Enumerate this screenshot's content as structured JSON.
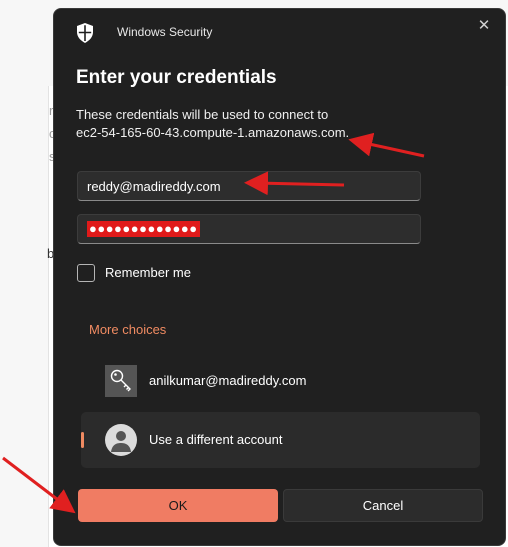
{
  "window": {
    "title": "Windows Security",
    "close_glyph": "✕"
  },
  "dialog": {
    "heading": "Enter your credentials",
    "description_line1": "These credentials will be used to connect to",
    "description_line2": "ec2-54-165-60-43.compute-1.amazonaws.com."
  },
  "fields": {
    "username_value": "reddy@madireddy.com",
    "password_masked": "●●●●●●●●●●●●●"
  },
  "remember": {
    "label": "Remember me",
    "checked": false
  },
  "more_choices": {
    "label": "More choices"
  },
  "accounts": [
    {
      "label": "anilkumar@madireddy.com",
      "icon": "key-icon"
    },
    {
      "label": "Use a different account",
      "icon": "user-avatar-icon",
      "selected": true
    }
  ],
  "buttons": {
    "ok": "OK",
    "cancel": "Cancel"
  },
  "background_fragments": [
    "r",
    "c",
    "s",
    "b"
  ],
  "colors": {
    "accent": "#f07c63",
    "link": "#f08b62",
    "annotation_arrow": "#e02020",
    "password_highlight": "#e01a1a"
  }
}
